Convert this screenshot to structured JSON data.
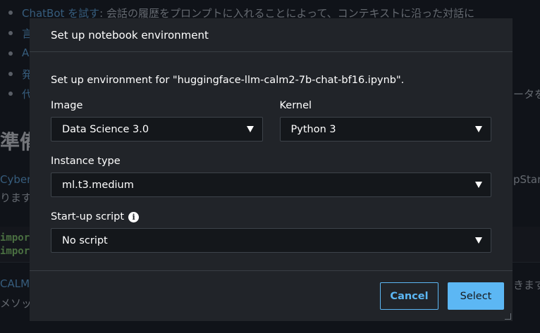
{
  "background": {
    "bullets": [
      {
        "link": "ChatBot を試す",
        "text": ": 会話の履歴をプロンプトに入れることによって、コンテキストに沿った対話に"
      },
      {
        "link": "",
        "text": "言"
      },
      {
        "link": "",
        "text": "A"
      },
      {
        "link": "",
        "text": "発"
      },
      {
        "link": "",
        "text": "代"
      }
    ],
    "right_fragment": "ータを",
    "heading": "準備",
    "para1_left": "Cyber",
    "para1_right": "pStar",
    "para2_left": "ります",
    "code_lines": [
      "impor",
      "impor"
    ],
    "bottom_left_1": "CALM",
    "bottom_right_1": "きます",
    "bottom_left_2": "メソッ"
  },
  "modal": {
    "title": "Set up notebook environment",
    "intro": "Set up environment for \"huggingface-llm-calm2-7b-chat-bf16.ipynb\".",
    "image": {
      "label": "Image",
      "value": "Data Science 3.0"
    },
    "kernel": {
      "label": "Kernel",
      "value": "Python 3"
    },
    "instance_type": {
      "label": "Instance type",
      "value": "ml.t3.medium"
    },
    "startup_script": {
      "label": "Start-up script",
      "value": "No script",
      "icon": "info-icon"
    },
    "buttons": {
      "cancel": "Cancel",
      "select": "Select"
    }
  },
  "colors": {
    "accent": "#5cb7f4",
    "modal_bg": "#212429",
    "field_bg": "#14171b"
  }
}
